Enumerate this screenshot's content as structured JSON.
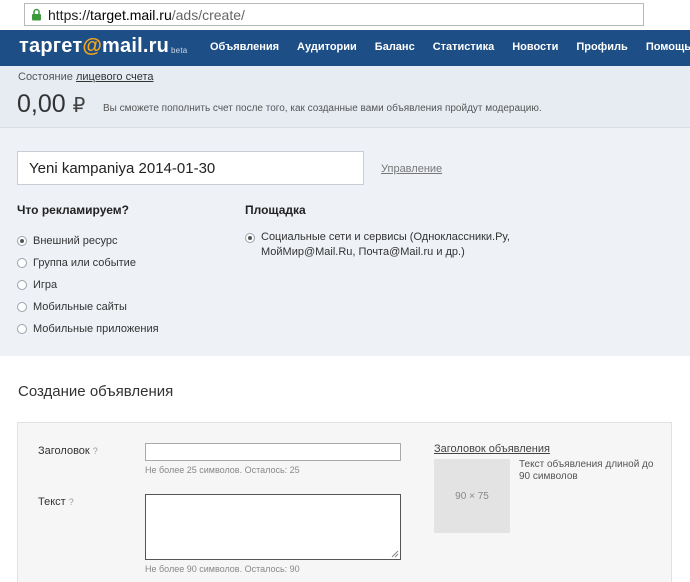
{
  "browser": {
    "url_scheme": "https://",
    "url_host": "target.mail.ru",
    "url_path": "/ads/create/"
  },
  "nav": {
    "logo_text": "таргет",
    "logo_at": "@",
    "logo_domain": "mail.ru",
    "logo_badge": "beta",
    "items": [
      "Объявления",
      "Аудитории",
      "Баланс",
      "Статистика",
      "Новости",
      "Профиль",
      "Помощь"
    ]
  },
  "balance": {
    "label": "Состояние",
    "label_link": "лицевого счета",
    "amount": "0,00",
    "currency": "₽",
    "note": "Вы сможете пополнить счет после того, как созданные вами объявления пройдут модерацию."
  },
  "campaign": {
    "name_value": "Yeni kampaniya 2014-01-30",
    "manage_link": "Управление",
    "what_heading": "Что рекламируем?",
    "what_options": [
      {
        "label": "Внешний ресурс",
        "selected": true
      },
      {
        "label": "Группа или событие",
        "selected": false
      },
      {
        "label": "Игра",
        "selected": false
      },
      {
        "label": "Мобильные сайты",
        "selected": false
      },
      {
        "label": "Мобильные приложения",
        "selected": false
      }
    ],
    "platform_heading": "Площадка",
    "platform_option": "Социальные сети и сервисы (Одноклассники.Ру, МойМир@Mail.Ru, Почта@Mail.ru и др.)"
  },
  "creation": {
    "section_title": "Создание объявления",
    "title_label": "Заголовок",
    "help_mark": "?",
    "title_value": "",
    "title_hint": "Не более 25 символов. Осталось: 25",
    "text_label": "Текст",
    "text_value": "",
    "text_hint": "Не более 90 символов. Осталось: 90",
    "preview_title": "Заголовок объявления",
    "preview_image_size": "90 × 75",
    "preview_text": "Текст объявления длиной до 90 символов"
  },
  "colors": {
    "navbar": "#1d4e86",
    "logo_accent": "#f7a61c",
    "balance_bg": "#e7ecf3",
    "campaign_bg": "#eef1f6"
  }
}
